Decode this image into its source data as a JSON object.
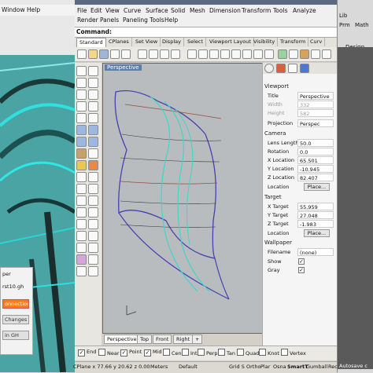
{
  "left_window": {
    "menu": [
      "Window",
      "Help"
    ],
    "panel": {
      "file_label": "per",
      "file_name": "rst10.gh",
      "connection_label": "onnection",
      "changes_label": "Changes",
      "gh_label": "in GH"
    }
  },
  "rhino": {
    "menu": [
      "File",
      "Edit",
      "View",
      "Curve",
      "Surface",
      "Solid",
      "Mesh",
      "Dimension",
      "Transform",
      "Tools",
      "Analyze",
      "Render",
      "Panels",
      "Paneling Tools",
      "Help"
    ],
    "command_label": "Command:",
    "toolbar_tabs": [
      "Standard",
      "CPlanes",
      "Set View",
      "Display",
      "Select",
      "Viewport Layout",
      "Visibility",
      "Transform",
      "Curv"
    ],
    "viewport": {
      "title": "Perspective",
      "tabs": [
        "Perspective",
        "Top",
        "Front",
        "Right"
      ],
      "add_tab": "+"
    },
    "properties": {
      "viewport_section": "Viewport",
      "rows": [
        {
          "label": "Title",
          "value": "Perspective"
        },
        {
          "label": "Width",
          "value": "332"
        },
        {
          "label": "Height",
          "value": "582"
        },
        {
          "label": "Projection",
          "value": "Perspec"
        }
      ],
      "camera_section": "Camera",
      "camera_rows": [
        {
          "label": "Lens Length",
          "value": "50.0"
        },
        {
          "label": "Rotation",
          "value": "0.0"
        },
        {
          "label": "X Location",
          "value": "65.501"
        },
        {
          "label": "Y Location",
          "value": "-10.945"
        },
        {
          "label": "Z Location",
          "value": "82.407"
        }
      ],
      "location_label": "Location",
      "place_label": "Place...",
      "target_section": "Target",
      "target_rows": [
        {
          "label": "X Target",
          "value": "55.959"
        },
        {
          "label": "Y Target",
          "value": "27.048"
        },
        {
          "label": "Z Target",
          "value": "-1.983"
        }
      ],
      "wallpaper_section": "Wallpaper",
      "filename_label": "Filename",
      "filename_value": "(none)",
      "show_label": "Show",
      "gray_label": "Gray"
    },
    "osnaps": [
      {
        "label": "End",
        "checked": true
      },
      {
        "label": "Near",
        "checked": false
      },
      {
        "label": "Point",
        "checked": true
      },
      {
        "label": "Mid",
        "checked": true
      },
      {
        "label": "Cen",
        "checked": false
      },
      {
        "label": "Int",
        "checked": false
      },
      {
        "label": "Perp",
        "checked": false
      },
      {
        "label": "Tan",
        "checked": false
      },
      {
        "label": "Quad",
        "checked": false
      },
      {
        "label": "Knot",
        "checked": false
      },
      {
        "label": "Vertex",
        "checked": false
      }
    ],
    "status": {
      "coords": "CPlane x 77.66  y 20.62  z 0.00",
      "units": "Meters",
      "layer": "Default",
      "modes": [
        "Grid S",
        "Ortho",
        "Plar",
        "Osna",
        "SmartT",
        "Gumball",
        "Record H"
      ]
    }
  },
  "right_window": {
    "tabs": [
      "Lib",
      "Prm",
      "Math"
    ],
    "design_label": "Design",
    "autosave_label": "Autosave c"
  },
  "colors": {
    "surface_edge": "#4a3fb0",
    "curve": "#3fd6c8",
    "iso_red": "#9a4a3a",
    "viewport_bg": "#b9bcbe"
  }
}
